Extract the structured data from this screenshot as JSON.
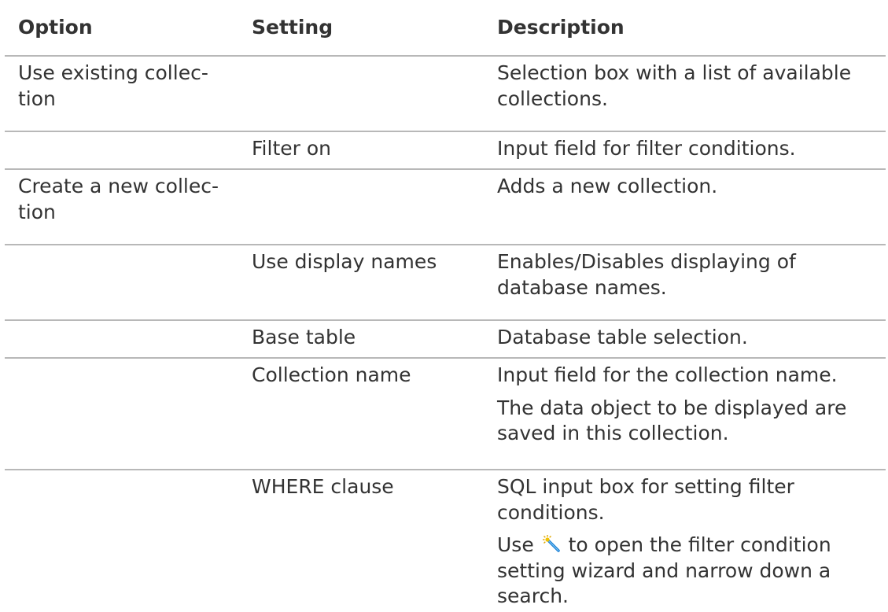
{
  "headers": {
    "option": "Option",
    "setting": "Setting",
    "description": "Description"
  },
  "rows": [
    {
      "option": [
        "Use existing collec-",
        "tion"
      ],
      "setting": "",
      "description": [
        "Selection box with a list of available",
        "collections."
      ]
    },
    {
      "option": [],
      "setting": "Filter on",
      "description": [
        "Input field for filter conditions."
      ]
    },
    {
      "option": [
        "Create a new collec-",
        "tion"
      ],
      "setting": "",
      "description": [
        "Adds a new collection."
      ]
    },
    {
      "option": [],
      "setting": "Use display names",
      "description": [
        "Enables/Disables displaying of",
        "database names."
      ]
    },
    {
      "option": [],
      "setting": "Base table",
      "description": [
        "Database table selection."
      ]
    },
    {
      "option": [],
      "setting": "Collection name",
      "description": [
        "Input field for the collection name."
      ],
      "description_p2": [
        "The data object to be displayed are",
        "saved in this collection."
      ]
    },
    {
      "option": [],
      "setting": "WHERE clause",
      "description": [
        "SQL input box for setting filter",
        "conditions."
      ],
      "description_p2_before_icon": "Use",
      "description_p2_icon": "magic-wand-icon",
      "description_p2_after_icon": "to open the filter condition",
      "description_p2_lines": [
        "setting wizard and narrow down a",
        "search."
      ]
    }
  ]
}
